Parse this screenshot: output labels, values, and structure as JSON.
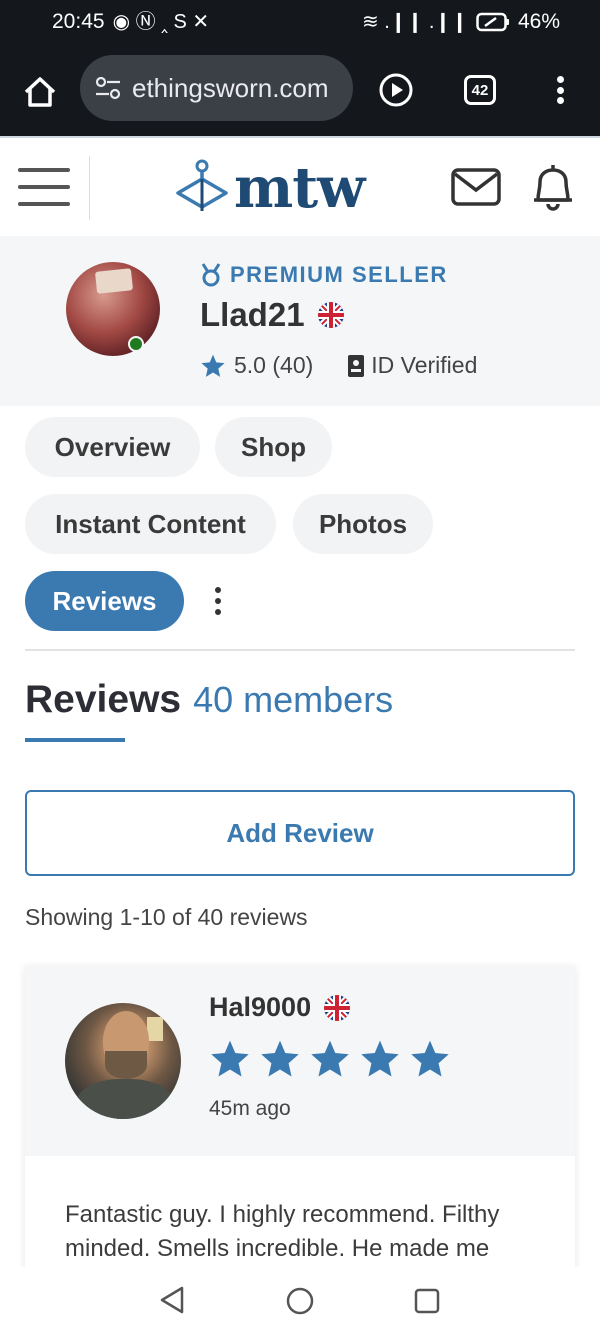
{
  "status_bar": {
    "time": "20:45",
    "left_glyphs": "◉ Ⓝ ‸ S ✕",
    "signal_glyphs": "≋ .❙❙ .❙❙",
    "battery": "46%"
  },
  "browser": {
    "url": "ethingsworn.com",
    "tab_count": "42"
  },
  "site": {
    "logo_text": "mtw",
    "brand_color": "#1e4a73",
    "accent_color": "#3a7ab0"
  },
  "profile": {
    "badge": "PREMIUM SELLER",
    "username": "Llad21",
    "rating": "5.0 (40)",
    "id_verified": "ID Verified",
    "online": true
  },
  "tabs": [
    {
      "label": "Overview",
      "active": false
    },
    {
      "label": "Shop",
      "active": false
    },
    {
      "label": "Instant Content",
      "active": false
    },
    {
      "label": "Photos",
      "active": false
    },
    {
      "label": "Reviews",
      "active": true
    }
  ],
  "reviews": {
    "title": "Reviews",
    "count_label": "40 members",
    "add_button": "Add Review",
    "showing": "Showing 1-10 of 40 reviews",
    "items": [
      {
        "reviewer": "Hal9000",
        "stars": 5,
        "time": "45m ago",
        "text": "Fantastic guy. I highly recommend. Filthy minded. Smells incredible. He made me"
      }
    ]
  }
}
